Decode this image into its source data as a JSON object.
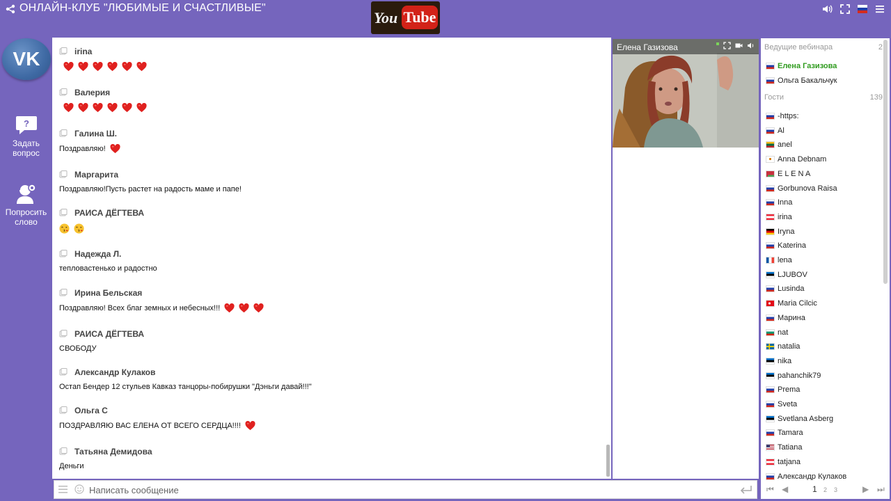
{
  "header": {
    "title": "ОНЛАЙН-КЛУБ \"ЛЮБИМЫЕ И СЧАСТЛИВЫЕ\"",
    "share_icon": "share-icon",
    "logo": {
      "you": "You",
      "tube": "Tube"
    },
    "right_icons": [
      "volume-icon",
      "fullscreen-icon",
      "russia-flag-icon",
      "menu-icon"
    ]
  },
  "sidebar": {
    "vk_label": "VK",
    "ask_question": {
      "line1": "Задать",
      "line2": "вопрос",
      "icon": "question-bubble-icon"
    },
    "request_word": {
      "line1": "Попросить",
      "line2": "слово",
      "icon": "headset-user-icon"
    }
  },
  "chat": {
    "messages": [
      {
        "author": "irina",
        "text": "",
        "hearts": 6
      },
      {
        "author": "Валерия",
        "text": "",
        "hearts": 6
      },
      {
        "author": "Галина Ш.",
        "text": "Поздравляю!",
        "hearts": 1
      },
      {
        "author": "Маргарита",
        "text": "Поздравляю!Пусть растет на радость маме и папе!",
        "hearts": 0
      },
      {
        "author": "РАИСА ДЁГТЕВА",
        "text": "",
        "kisses": 2
      },
      {
        "author": "Надежда Л.",
        "text": "тепловастенько и радостно",
        "hearts": 0
      },
      {
        "author": "Ирина Бельская",
        "text": "Поздравляю! Всех благ земных и небесных!!!",
        "hearts": 3
      },
      {
        "author": "РАИСА ДЁГТЕВА",
        "text": "СВОБОДУ",
        "hearts": 0
      },
      {
        "author": "Александр Кулаков",
        "text": "Остап Бендер 12 стульев Кавказ танцоры-побирушки \"Дэньги давай!!!\"",
        "hearts": 0
      },
      {
        "author": "Ольга С",
        "text": "ПОЗДРАВЛЯЮ ВАС ЕЛЕНА ОТ ВСЕГО СЕРДЦА!!!!",
        "hearts": 1
      },
      {
        "author": "Татьяна Демидова",
        "text": "Деньги",
        "hearts": 0
      }
    ],
    "input_placeholder": "Написать сообщение"
  },
  "video": {
    "presenter_name": "Елена Газизова"
  },
  "participants": {
    "hosts_label": "Ведущие вебинара",
    "hosts_count": "2",
    "hosts": [
      {
        "name": "Елена Газизова",
        "flag": "ru",
        "active": true
      },
      {
        "name": "Ольга Бакальчук",
        "flag": "ru",
        "active": false
      }
    ],
    "guests_label": "Гости",
    "guests_count": "139",
    "guests": [
      {
        "name": "-https:",
        "flag": "ru"
      },
      {
        "name": "Al",
        "flag": "ru"
      },
      {
        "name": "anel",
        "flag": "lt"
      },
      {
        "name": "Anna Debnam",
        "flag": "cy"
      },
      {
        "name": "E L E N A",
        "flag": "by"
      },
      {
        "name": "Gorbunova Raisa",
        "flag": "ru"
      },
      {
        "name": "Inna",
        "flag": "ru"
      },
      {
        "name": "irina",
        "flag": "at"
      },
      {
        "name": "Iryna",
        "flag": "de"
      },
      {
        "name": "Katerina",
        "flag": "ru"
      },
      {
        "name": "lena",
        "flag": "fr"
      },
      {
        "name": "LJUBOV",
        "flag": "ee"
      },
      {
        "name": "Lusinda",
        "flag": "ru"
      },
      {
        "name": "Maria Cilcic",
        "flag": "tr"
      },
      {
        "name": "Марина",
        "flag": "ru"
      },
      {
        "name": "nat",
        "flag": "bg"
      },
      {
        "name": "natalia",
        "flag": "se"
      },
      {
        "name": "nika",
        "flag": "ee"
      },
      {
        "name": "pahanchik79",
        "flag": "ee"
      },
      {
        "name": "Prema",
        "flag": "ru"
      },
      {
        "name": "Sveta",
        "flag": "ru"
      },
      {
        "name": "Svetlana Asberg",
        "flag": "ee"
      },
      {
        "name": "Tamara",
        "flag": "ru"
      },
      {
        "name": "Tatiana",
        "flag": "us"
      },
      {
        "name": "tatjana",
        "flag": "at"
      },
      {
        "name": "Александр Кулаков",
        "flag": "ru"
      }
    ],
    "pager": {
      "current": "1",
      "pages": [
        "2",
        "3"
      ]
    }
  },
  "colors": {
    "background": "#7565bd",
    "host_active": "#2f9b1e",
    "heart": "#e0211f"
  }
}
